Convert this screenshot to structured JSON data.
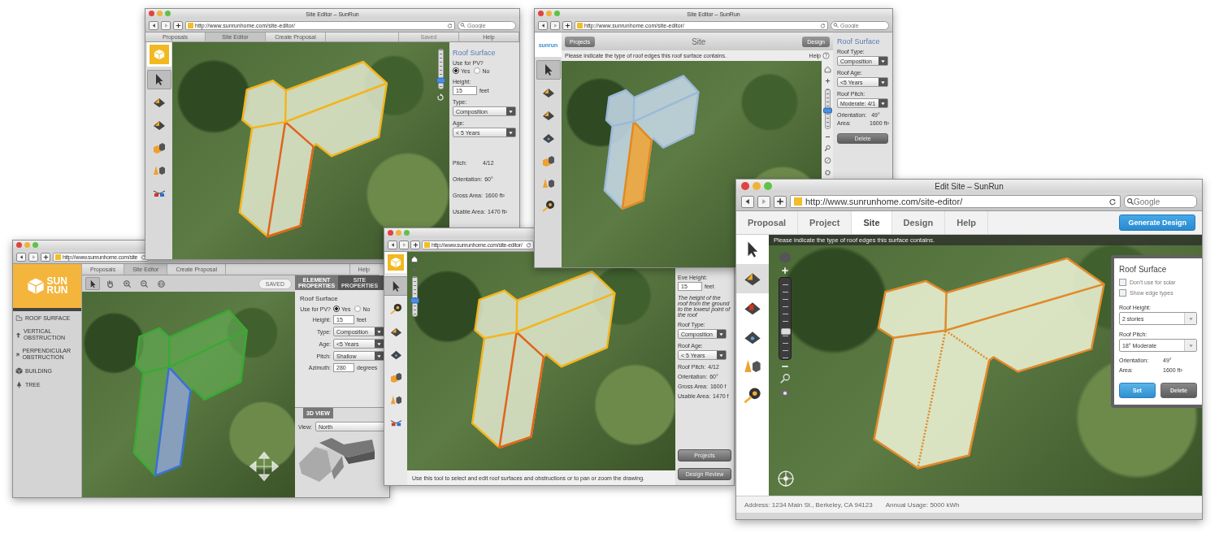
{
  "windows": [
    {
      "kind": "classic",
      "title": "Site Editor – SunRun",
      "url": "http://www.sunrunhome.com/site-editor/",
      "search": {
        "placeholder": "Google"
      },
      "tabs": [
        {
          "label": "Proposals",
          "selected": false,
          "disabled": false
        },
        {
          "label": "Site Editor",
          "selected": true,
          "disabled": false
        },
        {
          "label": "Create Proposal",
          "selected": false,
          "disabled": false
        },
        {
          "label": "Saved",
          "selected": false,
          "disabled": true
        },
        {
          "label": "Help",
          "selected": false,
          "disabled": false
        }
      ],
      "tools": [
        {
          "kind": "pointer",
          "selected": true
        },
        {
          "kind": "roof",
          "selected": false
        },
        {
          "kind": "roof",
          "selected": false
        },
        {
          "kind": "building",
          "selected": false
        },
        {
          "kind": "tree",
          "selected": false
        },
        {
          "kind": "glasses",
          "selected": false
        }
      ],
      "zoom": {
        "level": 0.2
      },
      "panel": {
        "items": [
          {
            "kind": "heading",
            "text": "Roof Surface"
          },
          {
            "kind": "radio_group",
            "label": "Use for PV?",
            "options": [
              {
                "label": "Yes",
                "selected": true
              },
              {
                "label": "No",
                "selected": false
              }
            ]
          },
          {
            "kind": "input",
            "label": "Height:",
            "value": "15",
            "unit": "feet"
          },
          {
            "kind": "select",
            "label": "Type:",
            "value": "Composition"
          },
          {
            "kind": "select",
            "label": "Age:",
            "value": "< 5 Years"
          },
          {
            "kind": "stat",
            "label": "Pitch:",
            "value": "4/12"
          },
          {
            "kind": "stat",
            "label": "Orientation:",
            "value": "60°"
          },
          {
            "kind": "stat",
            "label": "Gross Area:",
            "value": "1600 ft²"
          },
          {
            "kind": "stat",
            "label": "Usable Area:",
            "value": "1470 ft²"
          }
        ]
      }
    },
    {
      "kind": "header",
      "title": "Site Editor – SunRun",
      "url": "http://www.sunrunhome.com/site-editor/",
      "search": {
        "placeholder": "Google"
      },
      "logo": "sunrun",
      "header": {
        "back": "Projects",
        "title": "Site",
        "next": "Design"
      },
      "hint": "Please indicate the type of roof edges this roof surface contains.",
      "help": "Help",
      "tools": [
        {
          "kind": "pointer",
          "selected": true
        },
        {
          "kind": "roof",
          "selected": false
        },
        {
          "kind": "roof",
          "selected": false
        },
        {
          "kind": "roof_dark",
          "selected": false
        },
        {
          "kind": "building",
          "selected": false
        },
        {
          "kind": "tree",
          "selected": false
        },
        {
          "kind": "tape",
          "selected": false
        }
      ],
      "zoom": {
        "level": 0.45
      },
      "panel": {
        "items": [
          {
            "kind": "heading",
            "text": "Roof Surface"
          },
          {
            "kind": "select",
            "label": "Roof Type:",
            "value": "Composition"
          },
          {
            "kind": "select",
            "label": "Roof Age:",
            "value": "<5 Years"
          },
          {
            "kind": "select",
            "label": "Roof Pitch:",
            "value": "Moderate: 4/1"
          },
          {
            "kind": "stat",
            "label": "Orientation:",
            "value": "49°"
          },
          {
            "kind": "stat",
            "label": "Area:",
            "value": "1600 ft²"
          },
          {
            "kind": "buttons",
            "buttons": [
              {
                "label": "Delete",
                "primary": false
              }
            ]
          }
        ]
      }
    },
    {
      "kind": "legacy",
      "url": "http://www.sunrunhome.com/site",
      "logo": [
        "SUN",
        "RUN"
      ],
      "tabs": [
        {
          "label": "Proposals",
          "selected": false
        },
        {
          "label": "Site Editor",
          "selected": true
        },
        {
          "label": "Create Proposal",
          "selected": false
        },
        {
          "label": "Help",
          "selected": false
        }
      ],
      "toolbar": [
        {
          "kind": "pointer",
          "selected": true
        },
        {
          "kind": "hand",
          "selected": false
        },
        {
          "kind": "zoom_in",
          "selected": false
        },
        {
          "kind": "zoom_out",
          "selected": false
        },
        {
          "kind": "fit",
          "selected": false
        }
      ],
      "saved": "SAVED",
      "sidebar": [
        {
          "kind": "roof",
          "label": "ROOF SURFACE"
        },
        {
          "kind": "vertical",
          "label": "VERTICAL OBSTRUCTION"
        },
        {
          "kind": "perpendicular",
          "label": "PERPENDICULAR OBSTRUCTION"
        },
        {
          "kind": "building",
          "label": "BUILDING"
        },
        {
          "kind": "tree",
          "label": "TREE"
        }
      ],
      "panel_tabs": [
        {
          "label": "ELEMENT PROPERTIES",
          "selected": true
        },
        {
          "label": "SITE PROPERTIES",
          "selected": false
        }
      ],
      "panel": {
        "items": [
          {
            "kind": "heading",
            "text": "Roof Surface"
          },
          {
            "kind": "radio_group",
            "label": "Use for PV?",
            "options": [
              {
                "label": "Yes",
                "selected": true
              },
              {
                "label": "No",
                "selected": false
              }
            ]
          },
          {
            "kind": "input",
            "label": "Height:",
            "value": "15",
            "unit": "feet"
          },
          {
            "kind": "select",
            "label": "Type:",
            "value": "Composition"
          },
          {
            "kind": "select",
            "label": "Age:",
            "value": "<5 Years"
          },
          {
            "kind": "select",
            "label": "Pitch:",
            "value": "Shallow"
          },
          {
            "kind": "input",
            "label": "Azimuth:",
            "value": "280",
            "unit": "degrees"
          }
        ]
      },
      "view3d": {
        "tab": "3D VIEW",
        "label": "View:",
        "value": "North"
      }
    },
    {
      "kind": "overlay",
      "url": "http://www.sunrunhome.com/site-editor/",
      "tools": [
        {
          "kind": "pointer",
          "selected": true
        },
        {
          "kind": "tape",
          "selected": false
        },
        {
          "kind": "roof",
          "selected": false
        },
        {
          "kind": "roof_dark",
          "selected": false
        },
        {
          "kind": "building",
          "selected": false
        },
        {
          "kind": "tree",
          "selected": false
        },
        {
          "kind": "glasses",
          "selected": false
        }
      ],
      "zoom": {
        "level": 0.4
      },
      "panel": {
        "items": [
          {
            "kind": "input",
            "label": "Eve Height:",
            "value": "15",
            "unit": "feet"
          },
          {
            "kind": "note",
            "text": "The height of the roof from the ground to the lowest point of the roof"
          },
          {
            "kind": "select",
            "label": "Roof Type:",
            "value": "Composition"
          },
          {
            "kind": "select",
            "label": "Roof Age:",
            "value": "< 5 Years"
          },
          {
            "kind": "stat",
            "label": "Roof Pitch:",
            "value": "4/12"
          },
          {
            "kind": "stat",
            "label": "Orientation:",
            "value": "60°"
          },
          {
            "kind": "stat",
            "label": "Gross Area:",
            "value": "1600 f"
          },
          {
            "kind": "stat",
            "label": "Usable Area:",
            "value": "1470 f"
          }
        ]
      },
      "nav_buttons": [
        "Projects",
        "Design Review"
      ],
      "footer": "Use this tool to select and edit roof surfaces and obstructions or to pan or zoom the drawing."
    },
    {
      "kind": "modern",
      "title": "Edit Site – SunRun",
      "url": "http://www.sunrunhome.com/site-editor/",
      "search": {
        "placeholder": "Google"
      },
      "tabs": [
        {
          "label": "Proposal",
          "selected": false
        },
        {
          "label": "Project",
          "selected": false
        },
        {
          "label": "Site",
          "selected": true
        },
        {
          "label": "Design",
          "selected": false
        },
        {
          "label": "Help",
          "selected": false
        }
      ],
      "action": "Generate Design",
      "tools": [
        {
          "kind": "pointer",
          "selected": false
        },
        {
          "kind": "roof",
          "selected": true
        },
        {
          "kind": "roof_red",
          "selected": false
        },
        {
          "kind": "roof_dark",
          "selected": false
        },
        {
          "kind": "tree",
          "selected": false
        },
        {
          "kind": "tape",
          "selected": false
        }
      ],
      "hint": "Please indicate the type of roof edges this surface contains.",
      "zoom": {
        "level": 0.34
      },
      "panel": {
        "items": [
          {
            "kind": "heading",
            "text": "Roof Surface"
          },
          {
            "kind": "checkbox",
            "label": "Don't use for solar",
            "checked": false
          },
          {
            "kind": "checkbox",
            "label": "Show edge types",
            "checked": false
          },
          {
            "kind": "select",
            "label": "Roof Height:",
            "value": "2 stories"
          },
          {
            "kind": "select",
            "label": "Roof Pitch:",
            "value": "18° Moderate"
          },
          {
            "kind": "stat",
            "label": "Orientation:",
            "value": "49°"
          },
          {
            "kind": "stat",
            "label": "Area:",
            "value": "1600 ft²"
          },
          {
            "kind": "buttons",
            "buttons": [
              {
                "label": "Set",
                "primary": true
              },
              {
                "label": "Delete",
                "primary": false
              }
            ]
          }
        ]
      },
      "status": [
        "Address: 1234 Main St., Berkeley, CA 94123",
        "Annual Usage: 5000 kWh"
      ]
    }
  ]
}
